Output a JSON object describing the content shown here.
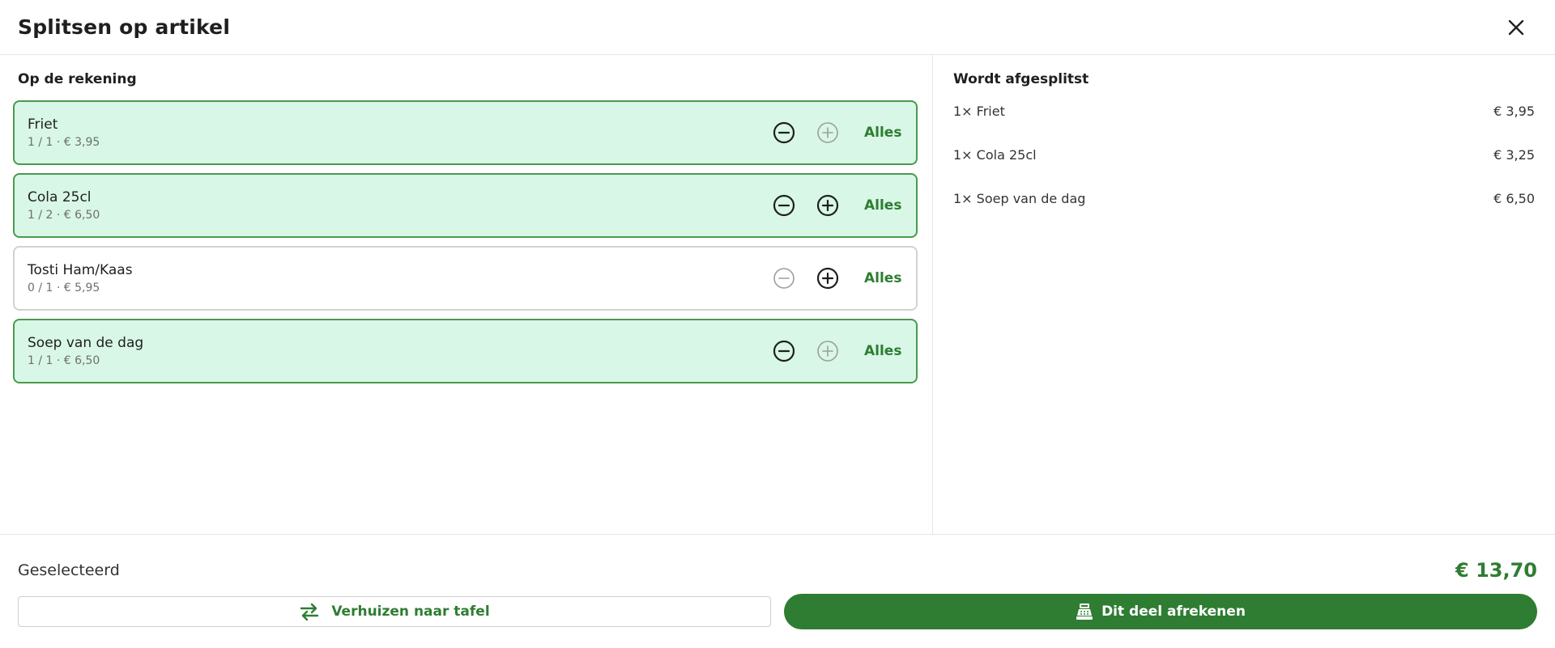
{
  "dialog": {
    "title": "Splitsen op artikel"
  },
  "left": {
    "title": "Op de rekening",
    "items": [
      {
        "name": "Friet",
        "sub": "1 / 1 · € 3,95",
        "selected": true,
        "minus_enabled": true,
        "plus_enabled": false,
        "all_label": "Alles"
      },
      {
        "name": "Cola 25cl",
        "sub": "1 / 2 · € 6,50",
        "selected": true,
        "minus_enabled": true,
        "plus_enabled": true,
        "all_label": "Alles"
      },
      {
        "name": "Tosti Ham/Kaas",
        "sub": "0 / 1 · € 5,95",
        "selected": false,
        "minus_enabled": false,
        "plus_enabled": true,
        "all_label": "Alles"
      },
      {
        "name": "Soep van de dag",
        "sub": "1 / 1 · € 6,50",
        "selected": true,
        "minus_enabled": true,
        "plus_enabled": false,
        "all_label": "Alles"
      }
    ]
  },
  "right": {
    "title": "Wordt afgesplitst",
    "rows": [
      {
        "label": "1× Friet",
        "price": "€ 3,95"
      },
      {
        "label": "1× Cola 25cl",
        "price": "€ 3,25"
      },
      {
        "label": "1× Soep van de dag",
        "price": "€ 6,50"
      }
    ]
  },
  "footer": {
    "selected_label": "Geselecteerd",
    "selected_total": "€ 13,70",
    "move_label": "Verhuizen naar tafel",
    "pay_label": "Dit deel afrekenen"
  },
  "icons": {
    "close": "close-icon",
    "minus": "minus-circle-icon",
    "plus": "plus-circle-icon",
    "move": "swap-arrows-icon",
    "pay": "cash-register-icon"
  },
  "colors": {
    "accent": "#2e7d32",
    "selected_bg": "#d8f7e6",
    "selected_border": "#4a9a4f",
    "disabled_icon": "#9e9e9e"
  }
}
